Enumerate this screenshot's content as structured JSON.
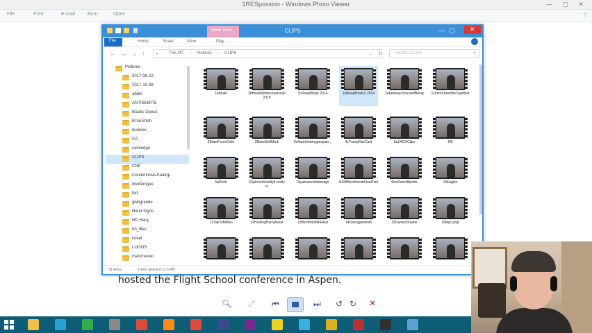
{
  "photo_viewer": {
    "title": "1RESpossion - Windows Photo Viewer",
    "menu": [
      "File",
      "Print",
      "E-mail",
      "Burn",
      "Open"
    ],
    "subtitle_text": "hosted the Flight School conference in Aspen."
  },
  "explorer": {
    "title": "CLIPS",
    "context_tab": "Video Tools",
    "ribbon_tabs": [
      "File",
      "Home",
      "Share",
      "View",
      "Play"
    ],
    "breadcrumb": [
      "This PC",
      "Pictures",
      "CLIPS"
    ],
    "search_placeholder": "Search CLIPS",
    "nav_items": [
      {
        "label": "Pictures",
        "selected": false
      },
      {
        "label": "2017-06-22",
        "selected": false
      },
      {
        "label": "2017-10-08",
        "selected": false
      },
      {
        "label": "abdol",
        "selected": false
      },
      {
        "label": "ANTISEMITE",
        "selected": false
      },
      {
        "label": "Blacks Dance",
        "selected": false
      },
      {
        "label": "B'nai B'rith",
        "selected": false
      },
      {
        "label": "bunnies",
        "selected": false
      },
      {
        "label": "CA",
        "selected": false
      },
      {
        "label": "camlodge",
        "selected": false
      },
      {
        "label": "CLIPS",
        "selected": true
      },
      {
        "label": "CNP",
        "selected": false
      },
      {
        "label": "Coudenhove-Kalergi",
        "selected": false
      },
      {
        "label": "dividtongue",
        "selected": false
      },
      {
        "label": "fed",
        "selected": false
      },
      {
        "label": "gwbgrande",
        "selected": false
      },
      {
        "label": "Hand Signs",
        "selected": false
      },
      {
        "label": "HD Hairy",
        "selected": false
      },
      {
        "label": "hh_files",
        "selected": false
      },
      {
        "label": "isreal",
        "selected": false
      },
      {
        "label": "LOGOS",
        "selected": false
      },
      {
        "label": "manchester",
        "selected": false
      }
    ],
    "files": [
      {
        "name": "1eMusk",
        "selected": false
      },
      {
        "name": "1bHeadMindsIsraelcode 2018",
        "selected": false
      },
      {
        "name": "1cReadMinds 2014",
        "selected": false
      },
      {
        "name": "1dReadMinds2 2014",
        "selected": true
      },
      {
        "name": "1eEmmaysYourselfBeingThinkAlike",
        "selected": false
      },
      {
        "name": "1OmniStreetWeTogether",
        "selected": false
      },
      {
        "name": "2BrainForceColle",
        "selected": false
      },
      {
        "name": "2BaneSoftMark",
        "selected": false
      },
      {
        "name": "3vAutothinkinggexplain_",
        "selected": false
      },
      {
        "name": "4cTrumpRacCast",
        "selected": false
      },
      {
        "name": "5aZACHClips",
        "selected": false
      },
      {
        "name": "9/9",
        "selected": false
      },
      {
        "name": "5aRock",
        "selected": false
      },
      {
        "name": "6SpinnerRealityIt really is",
        "selected": false
      },
      {
        "name": "7AyahuascaMessage",
        "selected": false
      },
      {
        "name": "8JRBMushroomFloatTanks",
        "selected": false
      },
      {
        "name": "9lexDuncAlbums",
        "selected": false
      },
      {
        "name": "10Eaglez",
        "selected": false
      },
      {
        "name": "11TalkToMMan",
        "selected": false
      },
      {
        "name": "12HoldingHarryAsset",
        "selected": false
      },
      {
        "name": "13BernBobbR&Red",
        "selected": false
      },
      {
        "name": "14Damagement5",
        "selected": false
      },
      {
        "name": "15DamesShame",
        "selected": false
      },
      {
        "name": "16MyCamp",
        "selected": false
      },
      {
        "name": "",
        "selected": false
      },
      {
        "name": "",
        "selected": false
      },
      {
        "name": "",
        "selected": false
      },
      {
        "name": "",
        "selected": false
      },
      {
        "name": "",
        "selected": false
      },
      {
        "name": "",
        "selected": false
      }
    ],
    "status_items": "31 items",
    "status_selected": "1 item selected  12.5 MB"
  },
  "colors": {
    "explorer_accent": "#3b8fd9",
    "taskbar": "#0d5d76",
    "close_red": "#d43a3a",
    "selection": "#cfe6fb"
  },
  "taskbar_apps": [
    "file-explorer",
    "ie",
    "store",
    "settings",
    "chrome",
    "firefox",
    "chrome",
    "photoshop",
    "premiere",
    "batman",
    "paint",
    "mail",
    "media",
    "obs",
    "monitor"
  ]
}
